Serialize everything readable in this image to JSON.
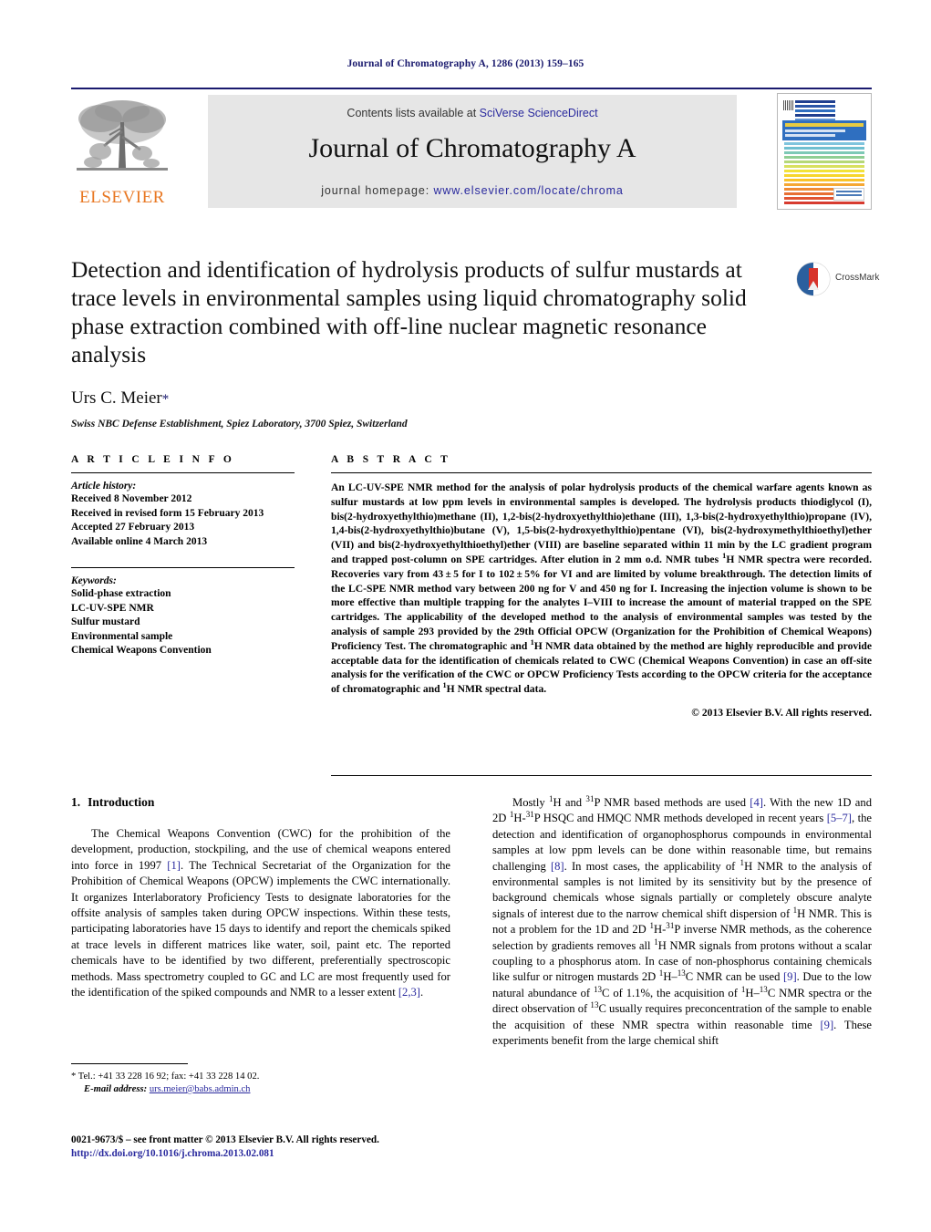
{
  "running_head": "Journal of Chromatography A, 1286 (2013) 159–165",
  "masthead": {
    "contents_prefix": "Contents lists available at ",
    "sciencedirect_link": "SciVerse ScienceDirect",
    "journal_title": "Journal of Chromatography A",
    "homepage_prefix": "journal homepage: ",
    "homepage_url": "www.elsevier.com/locate/chroma",
    "publisher_name": "ELSEVIER",
    "cover_title": "JOURNAL OF CHROMATOGRAPHY A",
    "link_color": "#2a2a9e",
    "publisher_color": "#E87722"
  },
  "article": {
    "title": "Detection and identification of hydrolysis products of sulfur mustards at trace levels in environmental samples using liquid chromatography solid phase extraction combined with off-line nuclear magnetic resonance analysis",
    "crossmark_label": "CrossMark",
    "author": "Urs C. Meier",
    "author_marker": "*",
    "affiliation": "Swiss NBC Defense Establishment, Spiez Laboratory, 3700 Spiez, Switzerland"
  },
  "article_info": {
    "heading": "A R T I C L E    I N F O",
    "history_label": "Article history:",
    "history": [
      "Received 8 November 2012",
      "Received in revised form 15 February 2013",
      "Accepted 27 February 2013",
      "Available online 4 March 2013"
    ],
    "keywords_label": "Keywords:",
    "keywords": [
      "Solid-phase extraction",
      "LC-UV-SPE NMR",
      "Sulfur mustard",
      "Environmental sample",
      "Chemical Weapons Convention"
    ]
  },
  "abstract": {
    "heading": "A B S T R A C T",
    "text": "An LC-UV-SPE NMR method for the analysis of polar hydrolysis products of the chemical warfare agents known as sulfur mustards at low ppm levels in environmental samples is developed. The hydrolysis products thiodiglycol (I), bis(2-hydroxyethylthio)methane (II), 1,2-bis(2-hydroxyethylthio)ethane (III), 1,3-bis(2-hydroxyethylthio)propane (IV), 1,4-bis(2-hydroxyethylthio)butane (V), 1,5-bis(2-hydroxyethylthio)pentane (VI), bis(2-hydroxymethylthioethyl)ether (VII) and bis(2-hydroxyethylthioethyl)ether (VIII) are baseline separated within 11 min by the LC gradient program and trapped post-column on SPE cartridges. After elution in 2 mm o.d. NMR tubes 1H NMR spectra were recorded. Recoveries vary from 43 ± 5 for I to 102 ± 5% for VI and are limited by volume breakthrough. The detection limits of the LC-SPE NMR method vary between 200 ng for V and 450 ng for I. Increasing the injection volume is shown to be more effective than multiple trapping for the analytes I–VIII to increase the amount of material trapped on the SPE cartridges. The applicability of the developed method to the analysis of environmental samples was tested by the analysis of sample 293 provided by the 29th Official OPCW (Organization for the Prohibition of Chemical Weapons) Proficiency Test. The chromatographic and 1H NMR data obtained by the method are highly reproducible and provide acceptable data for the identification of chemicals related to CWC (Chemical Weapons Convention) in case an off-site analysis for the verification of the CWC or OPCW Proficiency Tests according to the OPCW criteria for the acceptance of chromatographic and 1H NMR spectral data.",
    "copyright": "© 2013 Elsevier B.V. All rights reserved."
  },
  "introduction": {
    "number": "1.",
    "title": "Introduction",
    "left_paragraph": "The Chemical Weapons Convention (CWC) for the prohibition of the development, production, stockpiling, and the use of chemical weapons entered into force in 1997 [1]. The Technical Secretariat of the Organization for the Prohibition of Chemical Weapons (OPCW) implements the CWC internationally. It organizes Interlaboratory Proficiency Tests to designate laboratories for the offsite analysis of samples taken during OPCW inspections. Within these tests, participating laboratories have 15 days to identify and report the chemicals spiked at trace levels in different matrices like water, soil, paint etc. The reported chemicals have to be identified by two different, preferentially spectroscopic methods. Mass spectrometry coupled to GC and LC are most frequently used for the identification of the spiked compounds and NMR to a lesser extent [2,3].",
    "right_paragraph": "Mostly 1H and 31P NMR based methods are used [4]. With the new 1D and 2D 1H-31P HSQC and HMQC NMR methods developed in recent years [5–7], the detection and identification of organophosphorus compounds in environmental samples at low ppm levels can be done within reasonable time, but remains challenging [8]. In most cases, the applicability of 1H NMR to the analysis of environmental samples is not limited by its sensitivity but by the presence of background chemicals whose signals partially or completely obscure analyte signals of interest due to the narrow chemical shift dispersion of 1H NMR. This is not a problem for the 1D and 2D 1H-31P inverse NMR methods, as the coherence selection by gradients removes all 1H NMR signals from protons without a scalar coupling to a phosphorus atom. In case of non-phosphorus containing chemicals like sulfur or nitrogen mustards 2D 1H–13C NMR can be used [9]. Due to the low natural abundance of 13C of 1.1%, the acquisition of 1H–13C NMR spectra or the direct observation of 13C usually requires preconcentration of the sample to enable the acquisition of these NMR spectra within reasonable time [9]. These experiments benefit from the large chemical shift"
  },
  "footnotes": {
    "tel_line": "* Tel.: +41 33 228 16 92; fax: +41 33 228 14 02.",
    "email_label": "E-mail address:",
    "email": "urs.meier@babs.admin.ch",
    "issn_line": "0021-9673/$ – see front matter © 2013 Elsevier B.V. All rights reserved.",
    "doi": "http://dx.doi.org/10.1016/j.chroma.2013.02.081"
  }
}
